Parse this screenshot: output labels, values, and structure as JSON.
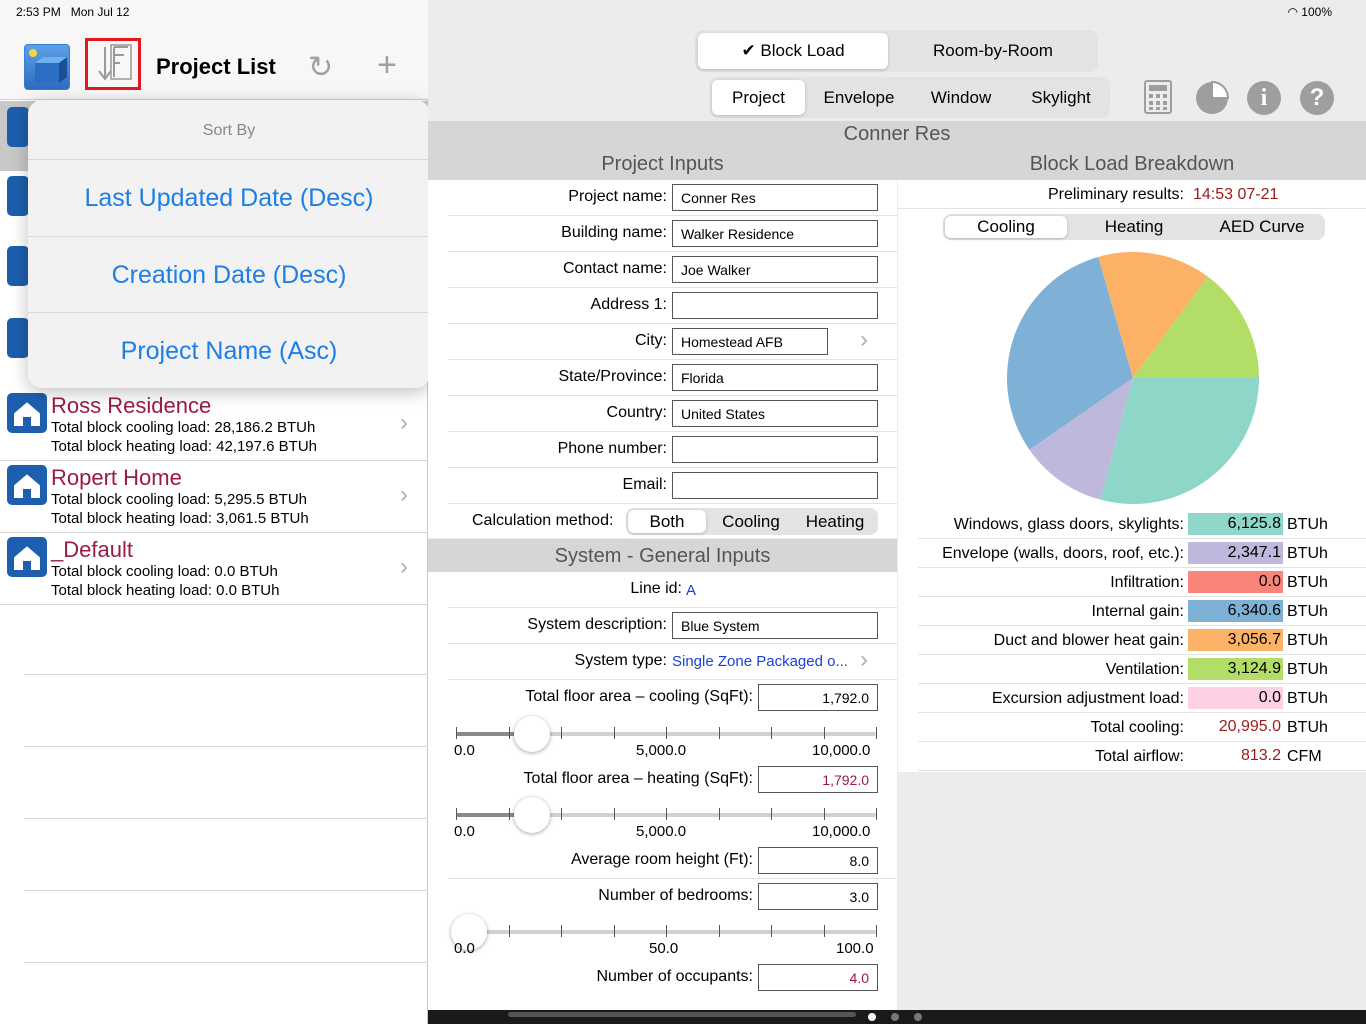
{
  "status": {
    "time": "2:53 PM",
    "date": "Mon Jul 12",
    "battery": "100%"
  },
  "left": {
    "title": "Project List",
    "sort_menu": {
      "title": "Sort By",
      "options": [
        "Last Updated Date (Desc)",
        "Creation Date (Desc)",
        "Project Name (Asc)"
      ]
    },
    "projects": [
      {
        "name": "Ross Residence",
        "cooling": "Total block cooling load: 28,186.2 BTUh",
        "heating": "Total block heating load: 42,197.6 BTUh"
      },
      {
        "name": "Ropert Home",
        "cooling": "Total block cooling load: 5,295.5 BTUh",
        "heating": "Total block heating load: 3,061.5 BTUh"
      },
      {
        "name": "_Default",
        "cooling": "Total block cooling load: 0.0 BTUh",
        "heating": "Total block heating load: 0.0 BTUh"
      }
    ]
  },
  "mode_tabs": {
    "block": "✔ Block Load",
    "room": "Room-by-Room"
  },
  "sub_tabs": [
    "Project",
    "Envelope",
    "Window",
    "Skylight"
  ],
  "project_title": "Conner Res",
  "inputs": {
    "heading": "Project Inputs",
    "fields": [
      {
        "label": "Project name:",
        "value": "Conner Res"
      },
      {
        "label": "Building name:",
        "value": "Walker Residence"
      },
      {
        "label": "Contact name:",
        "value": "Joe Walker"
      },
      {
        "label": "Address 1:",
        "value": ""
      },
      {
        "label": "City:",
        "value": "Homestead AFB"
      },
      {
        "label": "State/Province:",
        "value": "Florida"
      },
      {
        "label": "Country:",
        "value": "United States"
      },
      {
        "label": "Phone number:",
        "value": ""
      },
      {
        "label": "Email:",
        "value": ""
      }
    ],
    "calc_method": {
      "label": "Calculation method:",
      "options": [
        "Both",
        "Cooling",
        "Heating"
      ]
    }
  },
  "system": {
    "heading": "System - General Inputs",
    "line_id": {
      "label": "Line id:",
      "value": "A"
    },
    "description": {
      "label": "System description:",
      "value": "Blue System"
    },
    "type": {
      "label": "System type:",
      "value": "Single Zone Packaged o..."
    },
    "floor_cooling": {
      "label": "Total floor area – cooling (SqFt):",
      "value": "1,792.0",
      "slider_fraction": 0.18
    },
    "floor_heating": {
      "label": "Total floor area – heating (SqFt):",
      "value": "1,792.0",
      "slider_fraction": 0.18
    },
    "floor_ticks": [
      "0.0",
      "5,000.0",
      "10,000.0"
    ],
    "room_height": {
      "label": "Average room height (Ft):",
      "value": "8.0"
    },
    "bedrooms": {
      "label": "Number of bedrooms:",
      "value": "3.0",
      "slider_fraction": 0.03
    },
    "bed_ticks": [
      "0.0",
      "50.0",
      "100.0"
    ],
    "occupants": {
      "label": "Number of occupants:",
      "value": "4.0"
    }
  },
  "breakdown": {
    "heading": "Block Load Breakdown",
    "prelim_label": "Preliminary results:",
    "prelim_value": "14:53 07-21",
    "tabs": [
      "Cooling",
      "Heating",
      "AED Curve"
    ],
    "rows": [
      {
        "label": "Windows, glass doors, skylights:",
        "value": "6,125.8",
        "unit": "BTUh",
        "color": "#8ed6c8"
      },
      {
        "label": "Envelope (walls, doors, roof, etc.):",
        "value": "2,347.1",
        "unit": "BTUh",
        "color": "#bdb8dc"
      },
      {
        "label": "Infiltration:",
        "value": "0.0",
        "unit": "BTUh",
        "color": "#f9857a"
      },
      {
        "label": "Internal gain:",
        "value": "6,340.6",
        "unit": "BTUh",
        "color": "#7fb1d6"
      },
      {
        "label": "Duct and blower heat gain:",
        "value": "3,056.7",
        "unit": "BTUh",
        "color": "#fbb266"
      },
      {
        "label": "Ventilation:",
        "value": "3,124.9",
        "unit": "BTUh",
        "color": "#b2de68"
      },
      {
        "label": "Excursion adjustment load:",
        "value": "0.0",
        "unit": "BTUh",
        "color": "#fdd0e4"
      },
      {
        "label": "Total cooling:",
        "value": "20,995.0",
        "unit": "BTUh",
        "color": ""
      },
      {
        "label": "Total airflow:",
        "value": "813.2",
        "unit": "CFM",
        "color": ""
      }
    ]
  },
  "chart_data": {
    "type": "pie",
    "categories": [
      "Windows, glass doors, skylights",
      "Envelope (walls, doors, roof, etc.)",
      "Internal gain",
      "Duct and blower heat gain",
      "Ventilation"
    ],
    "values": [
      6125.8,
      2347.1,
      6340.6,
      3056.7,
      3124.9
    ],
    "colors": [
      "#8ed6c8",
      "#bdb8dc",
      "#7fb1d6",
      "#fbb266",
      "#b2de68"
    ]
  }
}
